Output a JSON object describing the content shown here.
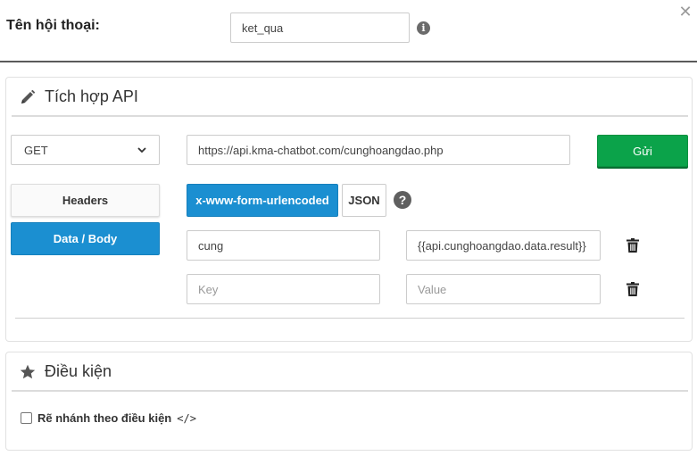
{
  "header": {
    "label": "Tên hội thoại:",
    "name_value": "ket_qua"
  },
  "api_panel": {
    "title": "Tích hợp API",
    "method": "GET",
    "url": "https://api.kma-chatbot.com/cunghoangdao.php",
    "send_label": "Gửi",
    "tabs": [
      {
        "label": "Headers",
        "active": false
      },
      {
        "label": "Data / Body",
        "active": true
      }
    ],
    "formats": [
      {
        "label": "x-www-form-urlencoded",
        "active": true
      },
      {
        "label": "JSON",
        "active": false
      }
    ],
    "help_glyph": "?",
    "rows": [
      {
        "key": "cung",
        "value": "{{api.cunghoangdao.data.result}}"
      },
      {
        "key": "",
        "value": ""
      }
    ],
    "key_placeholder": "Key",
    "value_placeholder": "Value"
  },
  "condition_panel": {
    "title": "Điều kiện",
    "checkbox_label": "Rẽ nhánh theo điều kiện",
    "checkbox_checked": false,
    "code_glyph": "</>"
  },
  "colors": {
    "send_green": "#0ba34a",
    "active_blue": "#1b8fd1"
  }
}
